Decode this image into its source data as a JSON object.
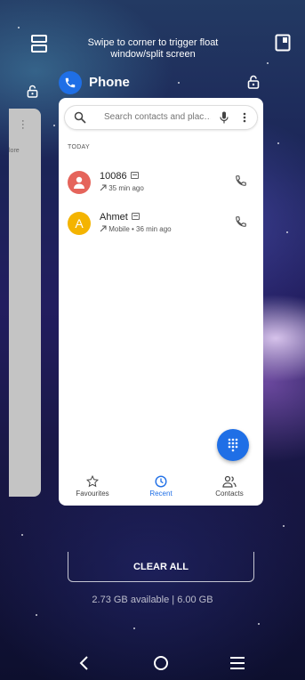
{
  "overlay": {
    "hint_text": "Swipe to corner to trigger float window/split screen",
    "app_title": "Phone"
  },
  "phone": {
    "search_placeholder": "Search contacts and plac…",
    "section_label": "TODAY",
    "calls": [
      {
        "name": "10086",
        "detail": "35 min ago",
        "avatar_letter": "",
        "avatar_color": "#e5645b"
      },
      {
        "name": "Ahmet",
        "detail": "Mobile • 36 min ago",
        "avatar_letter": "A",
        "avatar_color": "#f4b400"
      }
    ],
    "tabs": [
      {
        "label": "Favourites",
        "icon": "star-icon"
      },
      {
        "label": "Recent",
        "icon": "clock-icon"
      },
      {
        "label": "Contacts",
        "icon": "contacts-icon"
      }
    ],
    "active_tab": "Recent",
    "left_card_fragment": "lore"
  },
  "recents": {
    "clear_all_label": "CLEAR ALL",
    "memory_text": "2.73 GB available | 6.00 GB"
  },
  "colors": {
    "accent": "#1f6fe6",
    "avatar_red": "#e5645b",
    "avatar_yellow": "#f4b400"
  }
}
